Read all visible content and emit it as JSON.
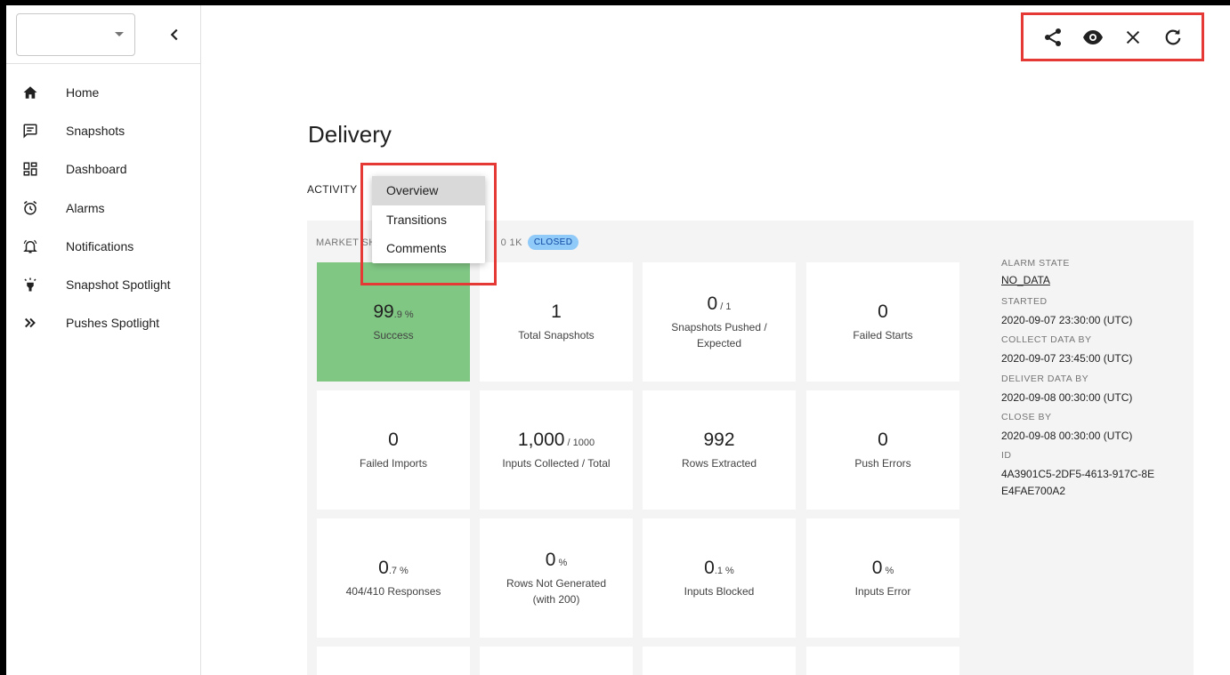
{
  "sidebar": {
    "items": [
      {
        "label": "Home",
        "icon": "home-icon"
      },
      {
        "label": "Snapshots",
        "icon": "message-icon"
      },
      {
        "label": "Dashboard",
        "icon": "dashboard-icon"
      },
      {
        "label": "Alarms",
        "icon": "alarm-icon"
      },
      {
        "label": "Notifications",
        "icon": "bell-icon"
      },
      {
        "label": "Snapshot Spotlight",
        "icon": "spotlight-icon"
      },
      {
        "label": "Pushes Spotlight",
        "icon": "double-chevron-icon"
      }
    ]
  },
  "page": {
    "title": "Delivery",
    "tab_label": "ACTIVITY"
  },
  "menu": {
    "items": [
      "Overview",
      "Transitions",
      "Comments"
    ],
    "active": "Overview"
  },
  "breadcrumb": {
    "prefix": "MARKET SH",
    "suffix": "0 1K",
    "status": "CLOSED"
  },
  "tiles": [
    {
      "value": "99",
      "unit": ".9 %",
      "label": "Success"
    },
    {
      "value": "1",
      "unit": "",
      "label": "Total Snapshots"
    },
    {
      "value": "0",
      "unit": " / 1",
      "label": "Snapshots Pushed / Expected"
    },
    {
      "value": "0",
      "unit": "",
      "label": "Failed Starts"
    },
    {
      "value": "0",
      "unit": "",
      "label": "Failed Imports"
    },
    {
      "value": "1,000",
      "unit": " / 1000",
      "label": "Inputs Collected / Total"
    },
    {
      "value": "992",
      "unit": "",
      "label": "Rows Extracted"
    },
    {
      "value": "0",
      "unit": "",
      "label": "Push Errors"
    },
    {
      "value": "0",
      "unit": ".7 %",
      "label": "404/410 Responses"
    },
    {
      "value": "0",
      "unit": " %",
      "label": "Rows Not Generated (with 200)"
    },
    {
      "value": "0",
      "unit": ".1 %",
      "label": "Inputs Blocked"
    },
    {
      "value": "0",
      "unit": " %",
      "label": "Inputs Error"
    }
  ],
  "info": {
    "alarm_state_label": "ALARM STATE",
    "alarm_state_value": "NO_DATA",
    "started_label": "STARTED",
    "started_value": "2020-09-07 23:30:00 (UTC)",
    "collect_label": "COLLECT DATA BY",
    "collect_value": "2020-09-07 23:45:00 (UTC)",
    "deliver_label": "DELIVER DATA BY",
    "deliver_value": "2020-09-08 00:30:00 (UTC)",
    "close_label": "CLOSE BY",
    "close_value": "2020-09-08 00:30:00 (UTC)",
    "id_label": "ID",
    "id_value": "4A3901C5-2DF5-4613-917C-8EE4FAE700A2"
  },
  "toolbar": {
    "icons": [
      "share-icon",
      "eye-icon",
      "close-icon",
      "refresh-icon"
    ]
  }
}
